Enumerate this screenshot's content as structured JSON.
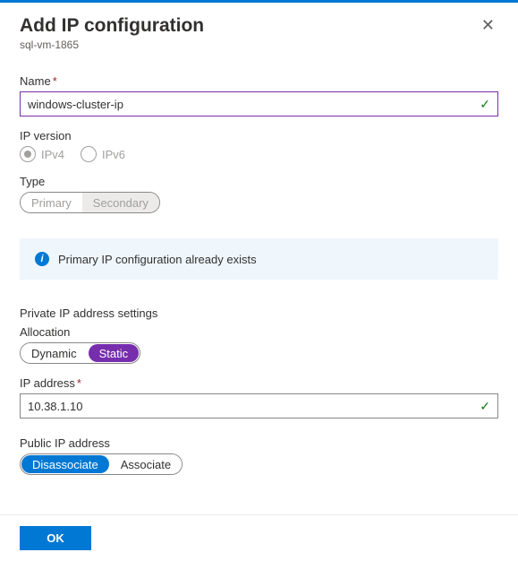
{
  "header": {
    "title": "Add IP configuration",
    "subtitle": "sql-vm-1865"
  },
  "name": {
    "label": "Name",
    "value": "windows-cluster-ip",
    "required": true,
    "valid": true
  },
  "ipVersion": {
    "label": "IP version",
    "options": {
      "ipv4": "IPv4",
      "ipv6": "IPv6"
    },
    "selected": "ipv4",
    "disabled": true
  },
  "type": {
    "label": "Type",
    "options": {
      "primary": "Primary",
      "secondary": "Secondary"
    },
    "selected": "secondary",
    "disabled": true
  },
  "info": {
    "message": "Primary IP configuration already exists"
  },
  "privateIp": {
    "sectionTitle": "Private IP address settings",
    "allocation": {
      "label": "Allocation",
      "options": {
        "dynamic": "Dynamic",
        "static": "Static"
      },
      "selected": "static"
    },
    "address": {
      "label": "IP address",
      "value": "10.38.1.10",
      "required": true,
      "valid": true
    }
  },
  "publicIp": {
    "label": "Public IP address",
    "options": {
      "disassociate": "Disassociate",
      "associate": "Associate"
    },
    "selected": "disassociate"
  },
  "footer": {
    "ok": "OK"
  }
}
